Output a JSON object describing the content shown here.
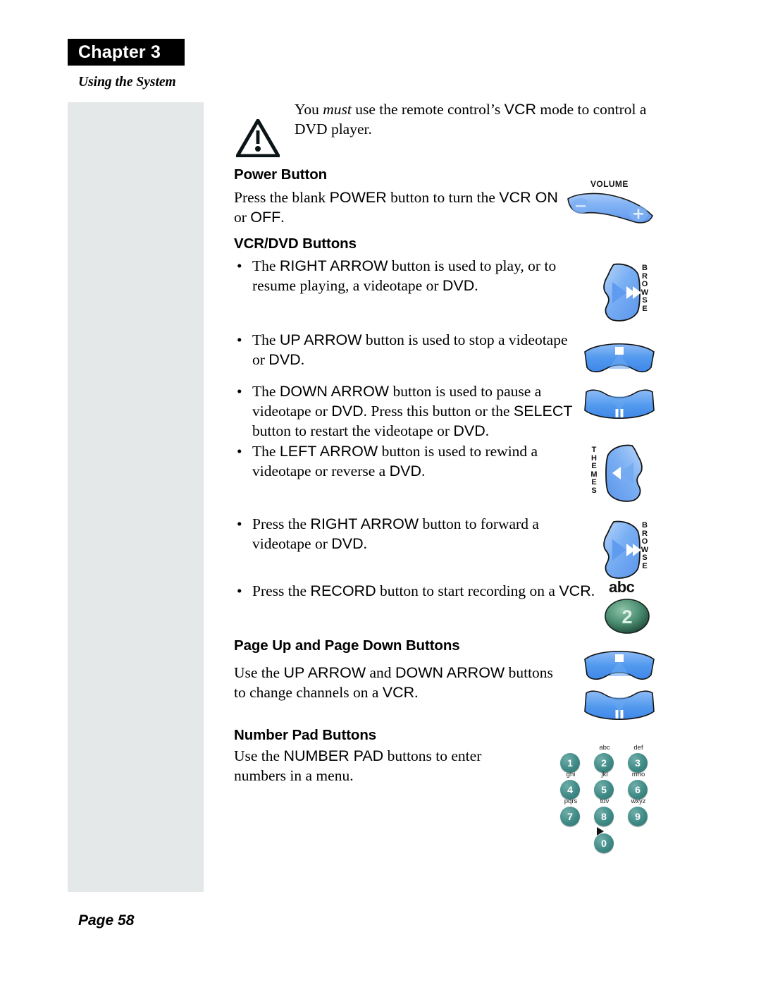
{
  "chapter": {
    "tab_label": "Chapter 3",
    "subtitle": "Using the System"
  },
  "footer": {
    "page_label": "Page 58"
  },
  "warning": {
    "icon": "warning-triangle-icon",
    "text_before_italic": "You ",
    "text_italic": "must",
    "text_after_italic": " use the remote control’s ",
    "text_sans_1": "VCR",
    "text_tail": " mode to control a DVD player."
  },
  "sections": {
    "power": {
      "heading": "Power Button",
      "body_1": "Press the blank ",
      "body_sans_1": "POWER",
      "body_2": " button to turn the ",
      "body_sans_2": "VCR ON",
      "body_3": " or ",
      "body_sans_3": "OFF",
      "body_4": "."
    },
    "vcrdvd": {
      "heading": "VCR/DVD Buttons",
      "bullets": [
        {
          "marker": "•",
          "text": "The RIGHT ARROW button is used to play, or to resume playing, a videotape or DVD.",
          "sans_terms": [
            "RIGHT ARROW",
            "DVD"
          ]
        },
        {
          "marker": "•",
          "text": "The UP ARROW button is used to stop a videotape or DVD.",
          "sans_terms": [
            "UP ARROW",
            "DVD"
          ]
        },
        {
          "marker": "•",
          "text": "The DOWN ARROW button is used to pause a videotape or DVD. Press this button or the SELECT button to restart the videotape or DVD.",
          "sans_terms": [
            "DOWN ARROW",
            "DVD",
            "SELECT"
          ]
        },
        {
          "marker": "•",
          "text": "The LEFT ARROW button is used to rewind a videotape or reverse a DVD.",
          "sans_terms": [
            "LEFT ARROW",
            "DVD"
          ]
        },
        {
          "marker": "•",
          "text": "Press the RIGHT ARROW button to forward a videotape or DVD.",
          "sans_terms": [
            "RIGHT ARROW",
            "DVD"
          ]
        },
        {
          "marker": "•",
          "text": "Press the RECORD button to start recording on a VCR.",
          "sans_terms": [
            "RECORD",
            "VCR"
          ]
        }
      ]
    },
    "pageupdown": {
      "heading": "Page Up and Page Down Buttons",
      "body_1": "Use the ",
      "body_sans_1": "UP ARROW",
      "body_2": " and ",
      "body_sans_2": "DOWN ARROW",
      "body_3": " buttons to change channels on a ",
      "body_sans_3": "VCR",
      "body_4": "."
    },
    "numberpad": {
      "heading": "Number Pad Buttons",
      "body_1": "Use the ",
      "body_sans_1": "NUMBER PAD",
      "body_2": " buttons to enter numbers in a menu."
    }
  },
  "artwork": {
    "volume_button": {
      "label": "VOLUME",
      "minus": "−",
      "plus": "+",
      "color": "#6fa8f0"
    },
    "browse_button_1": {
      "label": "BROWSE",
      "label_chars": [
        "B",
        "R",
        "O",
        "W",
        "S",
        "E"
      ],
      "icon": "fast-forward-icon",
      "color": "#6fa8f0"
    },
    "stop_button_1": {
      "icon": "stop-square-icon",
      "color": "#4b90ee"
    },
    "pause_button_1": {
      "icon": "pause-bars-icon",
      "color": "#4b90ee"
    },
    "themes_button": {
      "label": "THEMES",
      "label_chars": [
        "T",
        "H",
        "E",
        "M",
        "E",
        "S"
      ],
      "icon": "rewind-icon",
      "color": "#6fa8f0"
    },
    "browse_button_2": {
      "label": "BROWSE",
      "label_chars": [
        "B",
        "R",
        "O",
        "W",
        "S",
        "E"
      ],
      "icon": "fast-forward-icon",
      "color": "#6fa8f0"
    },
    "record_button": {
      "letters": "abc",
      "digit": "2",
      "color": "#3f7d63"
    },
    "stop_button_2": {
      "icon": "stop-square-icon",
      "color": "#4b90ee"
    },
    "pause_button_2": {
      "icon": "pause-bars-icon",
      "color": "#4b90ee"
    },
    "number_pad": {
      "key_color": "#3f8a86",
      "play_icon": "play-triangle-icon",
      "keys": [
        {
          "digit": "1",
          "letters": ""
        },
        {
          "digit": "2",
          "letters": "abc"
        },
        {
          "digit": "3",
          "letters": "def"
        },
        {
          "digit": "4",
          "letters": "ghi"
        },
        {
          "digit": "5",
          "letters": "jkl"
        },
        {
          "digit": "6",
          "letters": "mno"
        },
        {
          "digit": "7",
          "letters": "pqrs"
        },
        {
          "digit": "8",
          "letters": "tuv"
        },
        {
          "digit": "9",
          "letters": "wxyz"
        },
        {
          "digit": "0",
          "letters": ""
        }
      ]
    }
  }
}
